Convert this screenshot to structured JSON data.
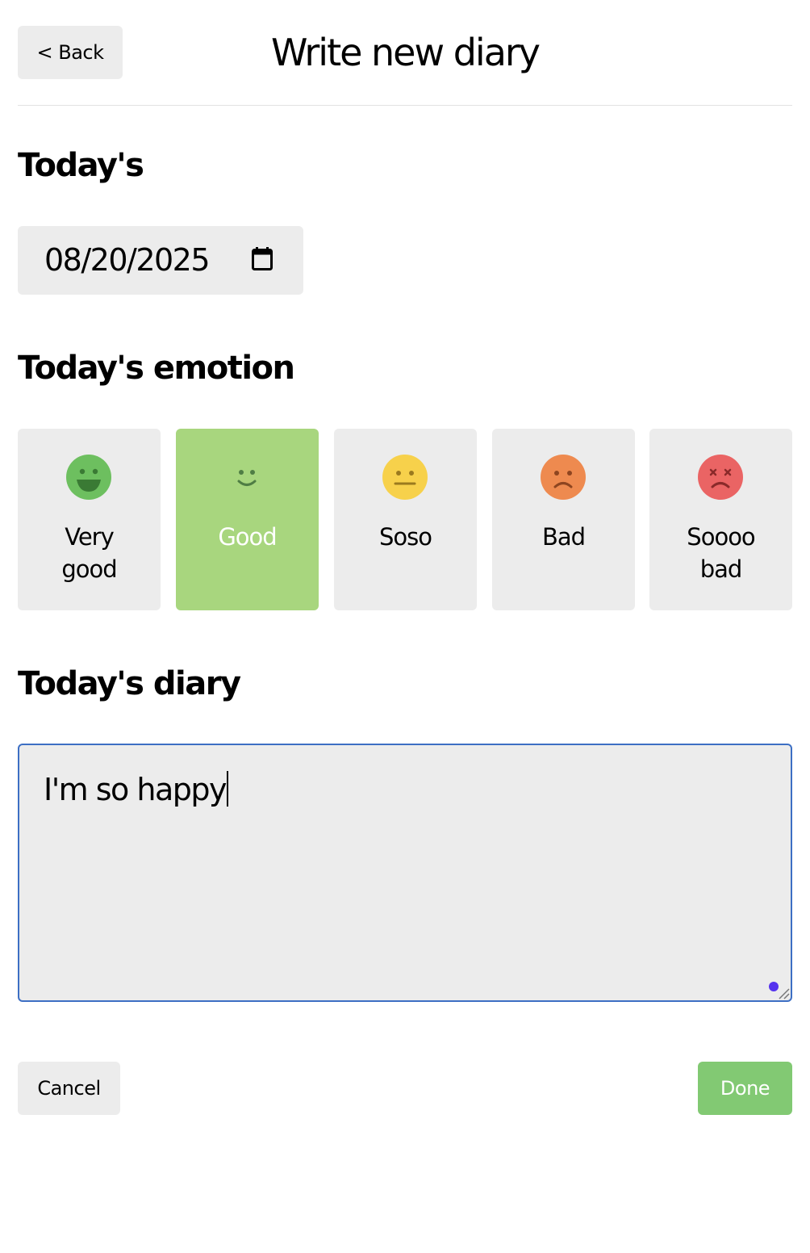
{
  "header": {
    "back_label": "< Back",
    "title": "Write new diary"
  },
  "date_section": {
    "title": "Today's",
    "date_value": "08/20/2025",
    "icon": "calendar-icon"
  },
  "emotion_section": {
    "title": "Today's emotion",
    "selected": "Good",
    "items": [
      {
        "label": "Very\ngood",
        "icon": "very-good-face-icon",
        "color": "#6dbf5f"
      },
      {
        "label": "Good",
        "icon": "good-face-icon",
        "color": "#a8d67e"
      },
      {
        "label": "Soso",
        "icon": "soso-face-icon",
        "color": "#f7d14b"
      },
      {
        "label": "Bad",
        "icon": "bad-face-icon",
        "color": "#ee8a4f"
      },
      {
        "label": "Soooo\nbad",
        "icon": "soooo-bad-face-icon",
        "color": "#ea6464"
      }
    ]
  },
  "diary_section": {
    "title": "Today's diary",
    "content": "I'm so happy"
  },
  "footer": {
    "cancel_label": "Cancel",
    "done_label": "Done"
  },
  "colors": {
    "accent_green": "#82c973",
    "selected_green": "#a8d67e",
    "focus_border": "#3d6fc4",
    "button_gray": "#ececec"
  }
}
